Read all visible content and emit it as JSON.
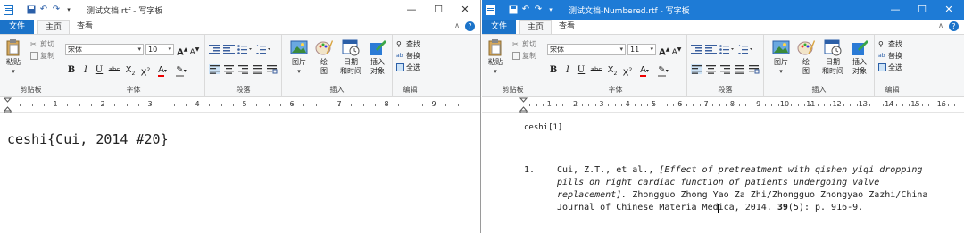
{
  "left": {
    "title": "测试文档.rtf - 写字板",
    "tabs": {
      "file": "文件",
      "home": "主页",
      "view": "查看"
    },
    "clipboard": {
      "paste": "粘贴",
      "cut": "剪切",
      "copy": "复制",
      "group": "剪贴板"
    },
    "font": {
      "name": "宋体",
      "size": "10",
      "group": "字体"
    },
    "paragraph": {
      "group": "段落"
    },
    "insert": {
      "picture": "图片",
      "paint1": "绘",
      "paint2": "图",
      "datetime1": "日期",
      "datetime2": "和时间",
      "object1": "插入",
      "object2": "对象",
      "group": "插入"
    },
    "edit": {
      "find": "查找",
      "replace": "替换",
      "selectall": "全选",
      "group": "编辑"
    },
    "doc": {
      "main": "ceshi{Cui, 2014 #20}"
    }
  },
  "right": {
    "title": "测试文档-Numbered.rtf - 写字板",
    "tabs": {
      "file": "文件",
      "home": "主页",
      "view": "查看"
    },
    "clipboard": {
      "paste": "粘贴",
      "cut": "剪切",
      "copy": "复制",
      "group": "剪贴板"
    },
    "font": {
      "name": "宋体",
      "size": "11",
      "group": "字体"
    },
    "paragraph": {
      "group": "段落"
    },
    "insert": {
      "picture": "图片",
      "paint1": "绘",
      "paint2": "图",
      "datetime1": "日期",
      "datetime2": "和时间",
      "object1": "插入",
      "object2": "对象",
      "group": "插入"
    },
    "edit": {
      "find": "查找",
      "replace": "替换",
      "selectall": "全选",
      "group": "编辑"
    },
    "doc": {
      "citation": "ceshi[1]",
      "ref_num": "1.",
      "line1_a": "Cui, Z.T., et al., ",
      "line1_b": "[Effect of pretreatment with qishen yiqi dropping",
      "line2": "pills on right cardiac function of patients undergoing valve",
      "line3_a": "replacement].",
      "line3_b": " Zhongguo Zhong Yao Za Zhi/Zhongguo Zhongyao Zazhi/China",
      "line4_a": "Journal of Chinese Materia Medica, 2014. ",
      "line4_b": "39",
      "line4_c": "(5): p. 916-9."
    }
  },
  "ruler_left": [
    "1",
    "2",
    "3",
    "4",
    "5",
    "6",
    "7",
    "8",
    "9"
  ],
  "ruler_right": [
    "1",
    "2",
    "3",
    "4",
    "5",
    "6",
    "7",
    "8",
    "9",
    "10",
    "11",
    "12",
    "13",
    "14",
    "15",
    "16"
  ],
  "colors": {
    "accent": "#1b73c9",
    "titlebar_active": "#1e7bd6"
  }
}
